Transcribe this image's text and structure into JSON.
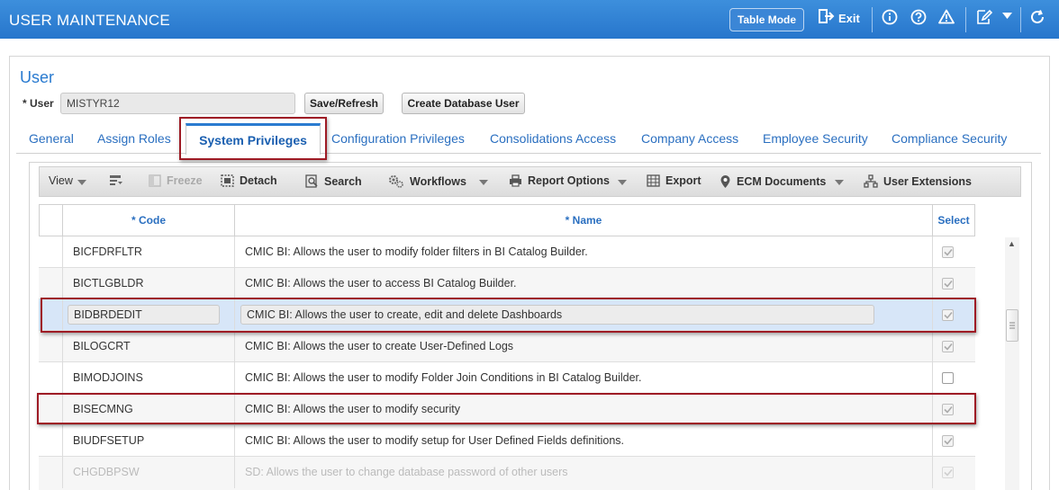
{
  "header": {
    "title": "USER MAINTENANCE",
    "table_mode_label": "Table Mode",
    "exit_label": "Exit",
    "icons": [
      "exit-icon",
      "info-icon",
      "help-icon",
      "warning-icon",
      "edit-icon",
      "chevron-down-icon",
      "refresh-icon"
    ]
  },
  "section": {
    "title": "User",
    "user_label": "* User",
    "user_value": "MISTYR12",
    "save_refresh_label": "Save/Refresh",
    "create_db_user_label": "Create Database User"
  },
  "tabs": [
    {
      "label": "General"
    },
    {
      "label": "Assign Roles"
    },
    {
      "label": "System Privileges",
      "active": true
    },
    {
      "label": "Configuration Privileges"
    },
    {
      "label": "Consolidations Access"
    },
    {
      "label": "Company Access"
    },
    {
      "label": "Employee Security"
    },
    {
      "label": "Compliance Security"
    }
  ],
  "toolbar": {
    "view_label": "View",
    "freeze_label": "Freeze",
    "detach_label": "Detach",
    "search_label": "Search",
    "workflows_label": "Workflows",
    "report_options_label": "Report Options",
    "export_label": "Export",
    "ecm_documents_label": "ECM Documents",
    "user_extensions_label": "User Extensions"
  },
  "grid": {
    "columns": {
      "code": "* Code",
      "name": "* Name",
      "select": "Select"
    },
    "rows": [
      {
        "code": "BICFDRFLTR",
        "name": "CMIC BI: Allows the user to modify folder filters in BI Catalog Builder.",
        "selected_flag": true
      },
      {
        "code": "BICTLGBLDR",
        "name": "CMIC BI: Allows the user to access BI Catalog Builder.",
        "selected_flag": true
      },
      {
        "code": "BIDBRDEDIT",
        "name": "CMIC BI: Allows the user to create, edit and delete Dashboards",
        "selected_flag": true
      },
      {
        "code": "BILOGCRT",
        "name": "CMIC BI: Allows the user to create User-Defined Logs",
        "selected_flag": true
      },
      {
        "code": "BIMODJOINS",
        "name": "CMIC BI: Allows the user to modify Folder Join Conditions in BI Catalog Builder.",
        "selected_flag": false
      },
      {
        "code": "BISECMNG",
        "name": "CMIC BI: Allows the user to modify security",
        "selected_flag": true
      },
      {
        "code": "BIUDFSETUP",
        "name": "CMIC BI: Allows the user to modify setup for User Defined Fields definitions.",
        "selected_flag": true
      },
      {
        "code": "CHGDBPSW",
        "name": "SD: Allows the user to change database password of other users",
        "selected_flag": true
      }
    ]
  },
  "colors": {
    "header_blue": "#2f7fd4",
    "link_blue": "#2a6fc0",
    "highlight_red": "#9e1b25",
    "selected_row": "#d7e6f8"
  }
}
